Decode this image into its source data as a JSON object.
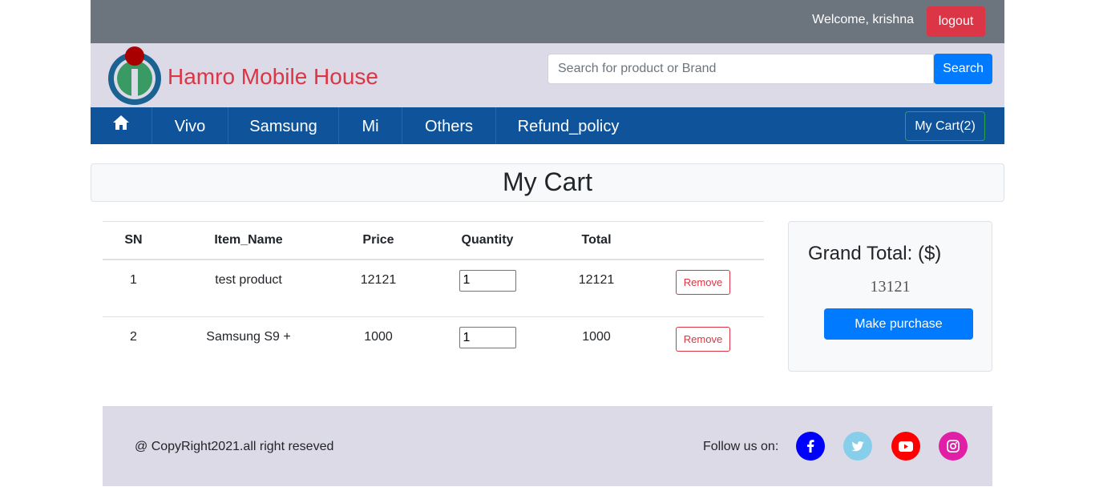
{
  "topbar": {
    "welcome": "Welcome, krishna",
    "logout_label": "logout"
  },
  "header": {
    "brand": "Hamro Mobile House",
    "search_placeholder": "Search for product or Brand",
    "search_label": "Search"
  },
  "nav": {
    "items": [
      {
        "label": "Vivo"
      },
      {
        "label": "Samsung"
      },
      {
        "label": "Mi"
      },
      {
        "label": "Others"
      },
      {
        "label": "Refund_policy"
      }
    ],
    "cart_label": "My Cart(2)"
  },
  "page_title": "My Cart",
  "table": {
    "headers": [
      "SN",
      "Item_Name",
      "Price",
      "Quantity",
      "Total",
      ""
    ],
    "rows": [
      {
        "sn": "1",
        "name": "test product",
        "price": "12121",
        "qty": "1",
        "total": "12121",
        "action": "Remove"
      },
      {
        "sn": "2",
        "name": "Samsung S9 +",
        "price": "1000",
        "qty": "1",
        "total": "1000",
        "action": "Remove"
      }
    ]
  },
  "summary": {
    "label": "Grand Total: ($)",
    "value": "13121",
    "purchase_label": "Make purchase"
  },
  "footer": {
    "copyright": "@ CopyRight2021.all right reseved",
    "follow": "Follow us on:",
    "social": [
      {
        "icon": "facebook-icon",
        "color": "#0000ff"
      },
      {
        "icon": "twitter-icon",
        "color": "#87ceeb"
      },
      {
        "icon": "youtube-icon",
        "color": "#ff0000"
      },
      {
        "icon": "instagram-icon",
        "color": "#e01fa6"
      }
    ]
  },
  "colors": {
    "topbar": "#6c757d",
    "header": "#dcdae6",
    "nav": "#0f539b",
    "brand": "#dc3545",
    "primary": "#007bff",
    "danger": "#dc3545",
    "success": "#28a745"
  }
}
